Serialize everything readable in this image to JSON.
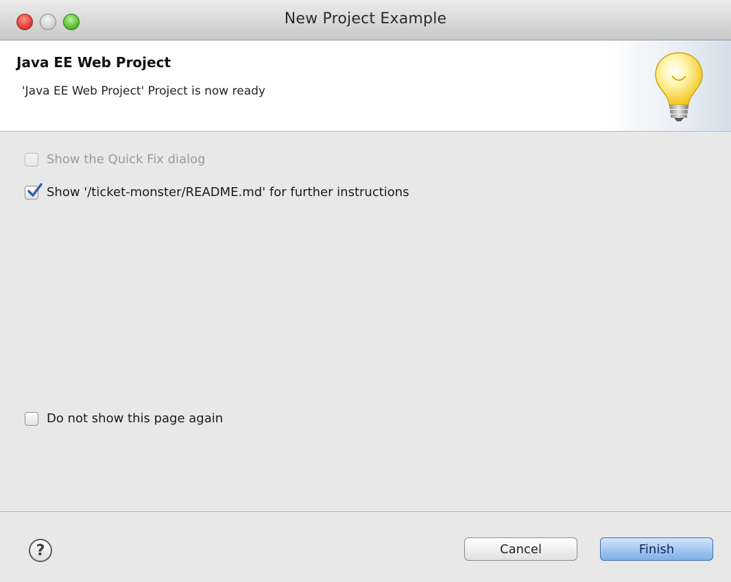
{
  "window": {
    "title": "New Project Example"
  },
  "header": {
    "title": "Java EE Web Project",
    "description": "'Java EE Web Project' Project is now ready"
  },
  "options": [
    {
      "label": "Show the Quick Fix dialog",
      "checked": false,
      "enabled": false
    },
    {
      "label": "Show '/ticket-monster/README.md' for further instructions",
      "checked": true,
      "enabled": true
    },
    {
      "label": "Do not show this page again",
      "checked": false,
      "enabled": true
    }
  ],
  "footer": {
    "help_symbol": "?",
    "cancel_label": "Cancel",
    "finish_label": "Finish"
  },
  "icons": {
    "banner": "lightbulb-icon",
    "help": "help-icon"
  },
  "colors": {
    "finish_button": "#a6c8f0",
    "close_button": "#e5463b",
    "zoom_button": "#5fc43a"
  }
}
